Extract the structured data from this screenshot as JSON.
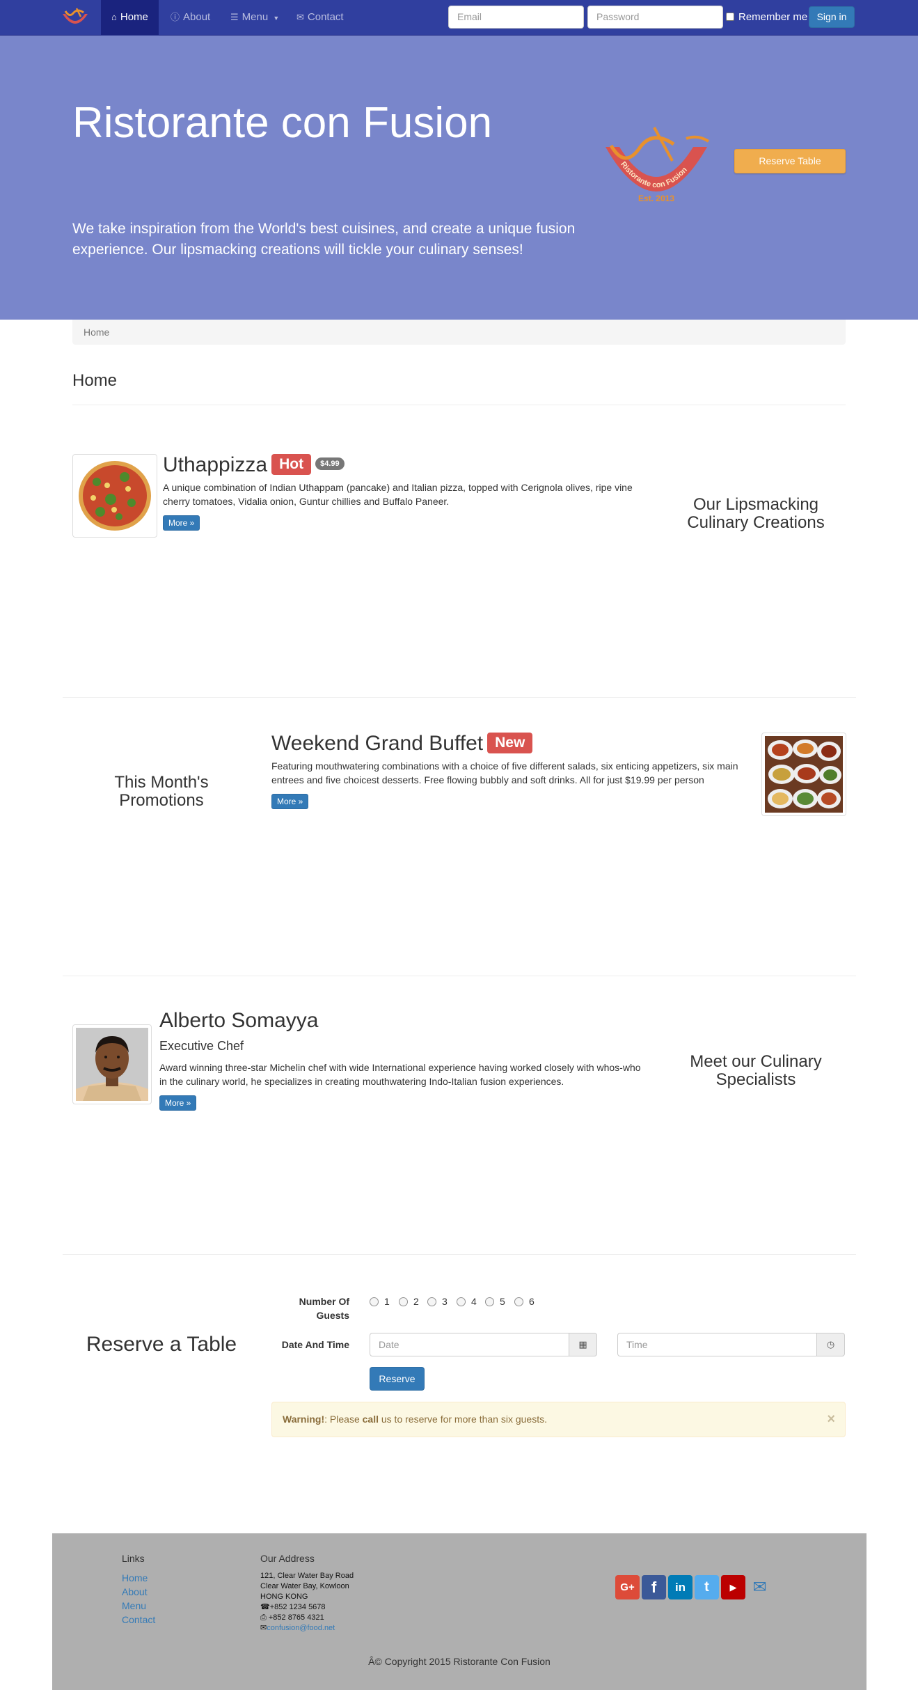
{
  "navbar": {
    "items": [
      {
        "label": "Home",
        "icon": "home-icon"
      },
      {
        "label": "About",
        "icon": "info-circle-icon"
      },
      {
        "label": "Menu",
        "icon": "list-icon"
      },
      {
        "label": "Contact",
        "icon": "envelope-icon"
      }
    ],
    "email_placeholder": "Email",
    "password_placeholder": "Password",
    "remember_label": "Remember me",
    "signin_label": "Sign in",
    "colors": {
      "bar": "#303F9F",
      "active": "#1A237E"
    }
  },
  "jumbotron": {
    "title": "Ristorante con Fusion",
    "text": "We take inspiration from the World's best cuisines, and create a unique fusion experience. Our lipsmacking creations will tickle your culinary senses!",
    "logo_text": "Ristorante con Fusion",
    "logo_est": "Est. 2013",
    "reserve_label": "Reserve Table",
    "color": "#7986CB"
  },
  "breadcrumb": {
    "item": "Home"
  },
  "page_title": "Home",
  "dish": {
    "name": "Uthappizza",
    "label": "Hot",
    "price": "$4.99",
    "description": "A unique combination of Indian Uthappam (pancake) and Italian pizza, topped with Cerignola olives, ripe vine cherry tomatoes, Vidalia onion, Guntur chillies and Buffalo Paneer.",
    "more_label": "More »",
    "side_heading": "Our Lipsmacking Culinary Creations"
  },
  "promotion": {
    "name": "Weekend Grand Buffet",
    "label": "New",
    "description": "Featuring mouthwatering combinations with a choice of five different salads, six enticing appetizers, six main entrees and five choicest desserts. Free flowing bubbly and soft drinks. All for just $19.99 per person",
    "more_label": "More »",
    "side_heading": "This Month's Promotions"
  },
  "leader": {
    "name": "Alberto Somayya",
    "designation": "Executive Chef",
    "description": "Award winning three-star Michelin chef with wide International experience having worked closely with whos-who in the culinary world, he specializes in creating mouthwatering Indo-Italian fusion experiences.",
    "more_label": "More »",
    "side_heading": "Meet our Culinary Specialists"
  },
  "reserve": {
    "heading": "Reserve a Table",
    "guests_label": "Number Of Guests",
    "guests_options": [
      "1",
      "2",
      "3",
      "4",
      "5",
      "6"
    ],
    "datetime_label": "Date And Time",
    "date_placeholder": "Date",
    "time_placeholder": "Time",
    "submit_label": "Reserve",
    "alert_strong": "Warning!",
    "alert_prefix": ": Please ",
    "alert_call": "call",
    "alert_suffix": " us to reserve for more than six guests.",
    "alert_close": "×"
  },
  "footer": {
    "links_heading": "Links",
    "links": [
      "Home",
      "About",
      "Menu",
      "Contact"
    ],
    "address_heading": "Our Address",
    "address_lines": [
      "121, Clear Water Bay Road",
      "Clear Water Bay, Kowloon",
      "HONG KONG"
    ],
    "phone": "+852 1234 5678",
    "fax": " +852 8765 4321",
    "email": "confusion@food.net",
    "social": [
      {
        "name": "google-plus-icon",
        "glyph": "G+",
        "color": "#dd4b39"
      },
      {
        "name": "facebook-icon",
        "glyph": "f",
        "color": "#3b5998"
      },
      {
        "name": "linkedin-icon",
        "glyph": "in",
        "color": "#007bb6"
      },
      {
        "name": "twitter-icon",
        "glyph": "t",
        "color": "#55acee"
      },
      {
        "name": "youtube-icon",
        "glyph": "▶",
        "color": "#bb0000"
      }
    ],
    "copyright": "Â© Copyright 2015 Ristorante Con Fusion",
    "color": "#AFAFAF"
  }
}
